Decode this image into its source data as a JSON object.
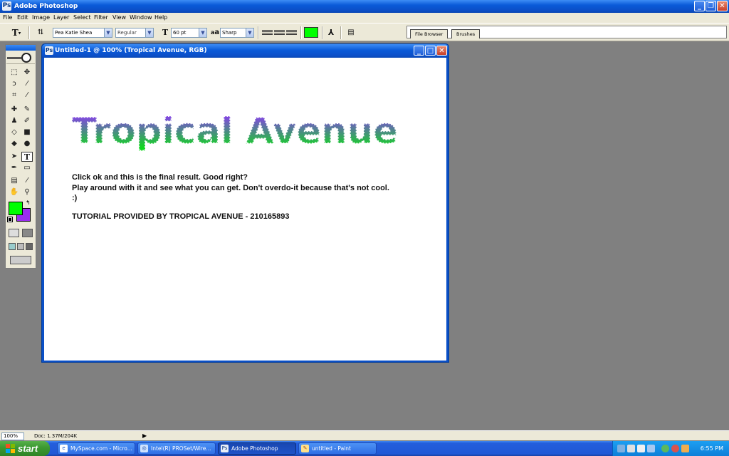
{
  "app": {
    "title": "Adobe Photoshop"
  },
  "menu": [
    "File",
    "Edit",
    "Image",
    "Layer",
    "Select",
    "Filter",
    "View",
    "Window",
    "Help"
  ],
  "options": {
    "font_family": "Pea Katie Shea",
    "font_style": "Regular",
    "font_size": "60 pt",
    "antialias_label": "a",
    "antialias_label2": "a",
    "antialias": "Sharp",
    "text_color": "#00ff00"
  },
  "palette_well": {
    "tabs": [
      "File Browser",
      "Brushes"
    ]
  },
  "toolbox": {
    "foreground_color": "#00ff00",
    "background_color": "#9b2cf0"
  },
  "document": {
    "title": "Untitled-1 @ 100% (Tropical Avenue, RGB)",
    "artwork_text": "Tropical Avenue",
    "gradient_top": "#8a3cf0",
    "gradient_bottom": "#10d81e",
    "lines": [
      "Click ok and this is the final result. Good right?",
      "Play around with it and see what you can get. Don't overdo-it because that's not cool.",
      ":)",
      "TUTORIAL PROVIDED BY TROPICAL AVENUE - 210165893"
    ]
  },
  "status": {
    "zoom": "100%",
    "doc": "Doc: 1.37M/204K"
  },
  "taskbar": {
    "start": "start",
    "tasks": [
      "MySpace.com - Micro...",
      "Intel(R) PROSet/Wire...",
      "Adobe Photoshop",
      "untitled - Paint"
    ],
    "clock": "6:55 PM"
  }
}
